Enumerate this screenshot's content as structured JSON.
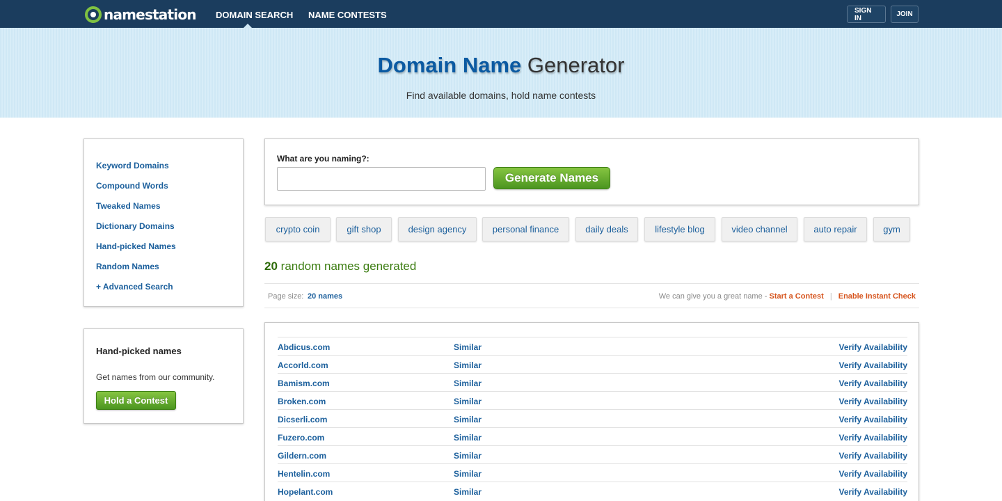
{
  "header": {
    "logo_text": "namestation",
    "nav": [
      {
        "label": "DOMAIN SEARCH",
        "active": true
      },
      {
        "label": "NAME CONTESTS",
        "active": false
      }
    ],
    "sign_in": "SIGN IN",
    "join": "JOIN"
  },
  "hero": {
    "title_bold": "Domain Name",
    "title_light": "Generator",
    "subtitle": "Find available domains, hold name contests"
  },
  "sidebar": {
    "links": [
      "Keyword Domains",
      "Compound Words",
      "Tweaked Names",
      "Dictionary Domains",
      "Hand-picked Names",
      "Random Names",
      "+ Advanced Search"
    ]
  },
  "community": {
    "title": "Hand-picked names",
    "text": "Get names from our community.",
    "button": "Hold a Contest"
  },
  "search": {
    "label": "What are you naming?:",
    "value": "",
    "placeholder": "",
    "button": "Generate Names"
  },
  "suggestions": [
    "crypto coin",
    "gift shop",
    "design agency",
    "personal finance",
    "daily deals",
    "lifestyle blog",
    "video channel",
    "auto repair",
    "gym"
  ],
  "results_summary": {
    "count": "20",
    "text": "random names generated"
  },
  "page_bar": {
    "page_size_label": "Page size:",
    "page_size_value": "20 names",
    "info_text": "We can give you a great name -",
    "start_contest": "Start a Contest",
    "separator": "|",
    "instant_check": "Enable Instant Check"
  },
  "results": {
    "similar_label": "Similar",
    "verify_label": "Verify Availability",
    "names": [
      "Abdicus.com",
      "Accorld.com",
      "Bamism.com",
      "Broken.com",
      "Dicserli.com",
      "Fuzero.com",
      "Gildern.com",
      "Hentelin.com",
      "Hopelant.com"
    ]
  },
  "colors": {
    "topbar": "#1b3d5e",
    "hero": "#cfe8f5",
    "link": "#1b5f9c",
    "green": "#4b9520",
    "orange": "#d6541d"
  }
}
